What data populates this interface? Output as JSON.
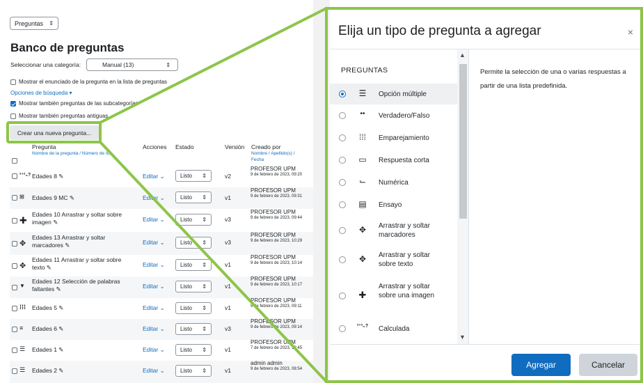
{
  "colors": {
    "accent": "#0f6cbf",
    "callout": "#8dc549"
  },
  "bank": {
    "nav_select": "Preguntas",
    "title": "Banco de preguntas",
    "category_label": "Seleccionar una categoría:",
    "category_value": "Manual (13)",
    "show_text_label": "Mostrar el enunciado de la pregunta en la lista de preguntas",
    "search_options": "Opciones de búsqueda",
    "show_subcat_label": "Mostrar también preguntas de las subcategorías",
    "show_old_label": "Mostrar también preguntas antiguas",
    "create_button": "Crear una nueva pregunta...",
    "columns": {
      "question": "Pregunta",
      "question_sub_a": "Nombre de la pregunta",
      "question_sub_sep": " / ",
      "question_sub_b": "Número de ID",
      "actions": "Acciones",
      "status": "Estado",
      "version": "Versión",
      "created_by": "Creado por",
      "created_sub_a": "Nombre",
      "created_sub_sep1": " / ",
      "created_sub_b": "Apellido(s)",
      "created_sub_sep2": " /",
      "created_sub_c": "Fecha"
    },
    "rows": [
      {
        "icon": "2+2=?",
        "name": "Edades 8",
        "edit": "Editar",
        "status": "Listo",
        "version": "v2",
        "author": "PROFESOR UPM",
        "date": "9 de febrero de 2023, 09:20"
      },
      {
        "icon": "multianswer",
        "name": "Edades 9 MC",
        "edit": "Editar",
        "status": "Listo",
        "version": "v1",
        "author": "PROFESOR UPM",
        "date": "9 de febrero de 2023, 09:31"
      },
      {
        "icon": "move",
        "name": "Edades 10 Arrastrar y soltar sobre imagen",
        "edit": "Editar",
        "status": "Listo",
        "version": "v3",
        "author": "PROFESOR UPM",
        "date": "9 de febrero de 2023, 09:44"
      },
      {
        "icon": "markers",
        "name": "Edades 13 Arrastrar y soltar marcadores",
        "edit": "Editar",
        "status": "Listo",
        "version": "v3",
        "author": "PROFESOR UPM",
        "date": "9 de febrero de 2023, 10:29"
      },
      {
        "icon": "ddwtos",
        "name": "Edades 11 Arrastrar y soltar sobre texto",
        "edit": "Editar",
        "status": "Listo",
        "version": "v1",
        "author": "PROFESOR UPM",
        "date": "9 de febrero de 2023, 10:14"
      },
      {
        "icon": "gapselect",
        "name": "Edades 12 Selección de palabras faltantes",
        "edit": "Editar",
        "status": "Listo",
        "version": "v1",
        "author": "PROFESOR UPM",
        "date": "9 de febrero de 2023, 10:17"
      },
      {
        "icon": "match",
        "name": "Edades 5",
        "edit": "Editar",
        "status": "Listo",
        "version": "v1",
        "author": "PROFESOR UPM",
        "date": "9 de febrero de 2023, 09:11"
      },
      {
        "icon": "calculated",
        "name": "Edades 6",
        "edit": "Editar",
        "status": "Listo",
        "version": "v3",
        "author": "PROFESOR UPM",
        "date": "9 de febrero de 2023, 09:14"
      },
      {
        "icon": "multichoice",
        "name": "Edades 1",
        "edit": "Editar",
        "status": "Listo",
        "version": "v1",
        "author": "PROFESOR UPM",
        "date": "7 de febrero de 2023, 12:45"
      },
      {
        "icon": "multichoice",
        "name": "Edades 2",
        "edit": "Editar",
        "status": "Listo",
        "version": "v1",
        "author": "admin admin",
        "date": "9 de febrero de 2023, 08:54"
      }
    ]
  },
  "dialog": {
    "title": "Elija un tipo de pregunta a agregar",
    "close": "×",
    "section": "PREGUNTAS",
    "types": [
      {
        "icon": "list-icon",
        "glyph": "☰",
        "label": "Opción múltiple",
        "selected": true
      },
      {
        "icon": "dots-icon",
        "glyph": "••",
        "label": "Verdadero/Falso",
        "selected": false
      },
      {
        "icon": "grid-icon",
        "glyph": "⁞⁞⁞",
        "label": "Emparejamiento",
        "selected": false
      },
      {
        "icon": "shortanswer-icon",
        "glyph": "▭",
        "label": "Respuesta corta",
        "selected": false
      },
      {
        "icon": "numerical-icon",
        "glyph": "⌙",
        "label": "Numérica",
        "selected": false
      },
      {
        "icon": "essay-icon",
        "glyph": "▤",
        "label": "Ensayo",
        "selected": false
      },
      {
        "icon": "markers-icon",
        "glyph": "✥",
        "label": "Arrastrar y soltar marcadores",
        "selected": false
      },
      {
        "icon": "ddwtos-icon",
        "glyph": "✥",
        "label": "Arrastrar y soltar sobre texto",
        "selected": false
      },
      {
        "icon": "move-icon",
        "glyph": "✚",
        "label": "Arrastrar y soltar sobre una imagen",
        "selected": false
      },
      {
        "icon": "calculated-icon",
        "glyph": "2+2=?",
        "label": "Calculada",
        "selected": false
      }
    ],
    "description": "Permite la selección de una o varias respuestas a partir de una lista predefinida.",
    "add_button": "Agregar",
    "cancel_button": "Cancelar"
  }
}
